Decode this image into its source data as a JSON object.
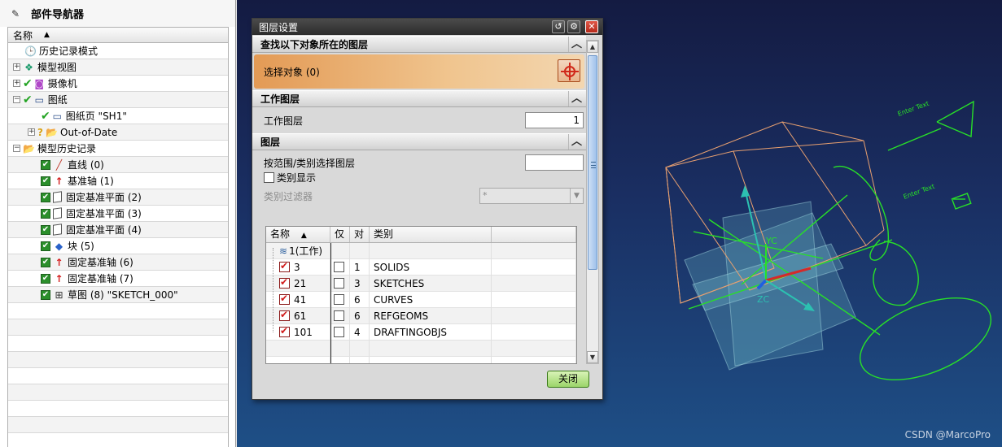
{
  "navigator": {
    "title": "部件导航器",
    "column_name": "名称",
    "items": [
      {
        "label": "历史记录模式",
        "icon": "clock-icon"
      },
      {
        "label": "模型视图",
        "icon": "model-views-icon"
      },
      {
        "label": "摄像机",
        "icon": "camera-icon"
      },
      {
        "label": "图纸",
        "icon": "drawing-icon"
      },
      {
        "label": "图纸页 \"SH1\"",
        "icon": "sheet-icon"
      },
      {
        "label": "Out-of-Date",
        "icon": "folder-icon"
      },
      {
        "label": "模型历史记录",
        "icon": "folder-icon"
      },
      {
        "label": "直线 (0)",
        "icon": "line-icon"
      },
      {
        "label": "基准轴 (1)",
        "icon": "datum-axis-icon"
      },
      {
        "label": "固定基准平面 (2)",
        "icon": "datum-plane-icon"
      },
      {
        "label": "固定基准平面 (3)",
        "icon": "datum-plane-icon"
      },
      {
        "label": "固定基准平面 (4)",
        "icon": "datum-plane-icon"
      },
      {
        "label": "块 (5)",
        "icon": "block-icon"
      },
      {
        "label": "固定基准轴 (6)",
        "icon": "datum-axis-icon"
      },
      {
        "label": "固定基准轴 (7)",
        "icon": "datum-axis-icon"
      },
      {
        "label": "草图 (8) \"SKETCH_000\"",
        "icon": "sketch-icon"
      }
    ]
  },
  "dialog": {
    "title": "图层设置",
    "section_find": "查找以下对象所在的图层",
    "select_object": "选择对象 (0)",
    "section_work": "工作图层",
    "work_layer_label": "工作图层",
    "work_layer_value": "1",
    "section_layers": "图层",
    "range_label": "按范围/类别选择图层",
    "range_value": "",
    "category_display": "类别显示",
    "category_filter_label": "类别过滤器",
    "category_filter_value": "*",
    "table": {
      "headers": [
        "名称",
        "仅",
        "对",
        "类别"
      ],
      "work_row": "1(工作)",
      "rows": [
        {
          "name": "3",
          "count": "1",
          "category": "SOLIDS"
        },
        {
          "name": "21",
          "count": "3",
          "category": "SKETCHES"
        },
        {
          "name": "41",
          "count": "6",
          "category": "CURVES"
        },
        {
          "name": "61",
          "count": "6",
          "category": "REFGEOMS"
        },
        {
          "name": "101",
          "count": "4",
          "category": "DRAFTINGOBJS"
        }
      ]
    },
    "close_label": "关闭"
  },
  "viewport": {
    "note_label": "Enter Text",
    "axis_y_label": "YC",
    "axis_z_label": "ZC",
    "watermark": "CSDN @MarcoPro"
  },
  "colors": {
    "accent_orange": "#e39a55",
    "check_green": "#2b8f2b",
    "viewport_top": "#141b42",
    "viewport_bottom": "#1e4f86"
  }
}
